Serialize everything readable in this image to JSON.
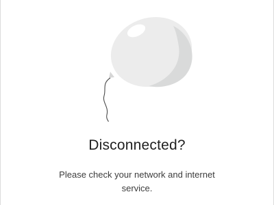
{
  "offline": {
    "illustration": "balloon-illustration",
    "title": "Disconnected?",
    "message": "Please check your network and internet service."
  },
  "colors": {
    "balloon_light": "#ececec",
    "balloon_shadow": "#d9dada",
    "highlight": "#ffffff",
    "string": "#4a4a4a",
    "title": "#1f1f1f",
    "message": "#3c3c3c"
  }
}
